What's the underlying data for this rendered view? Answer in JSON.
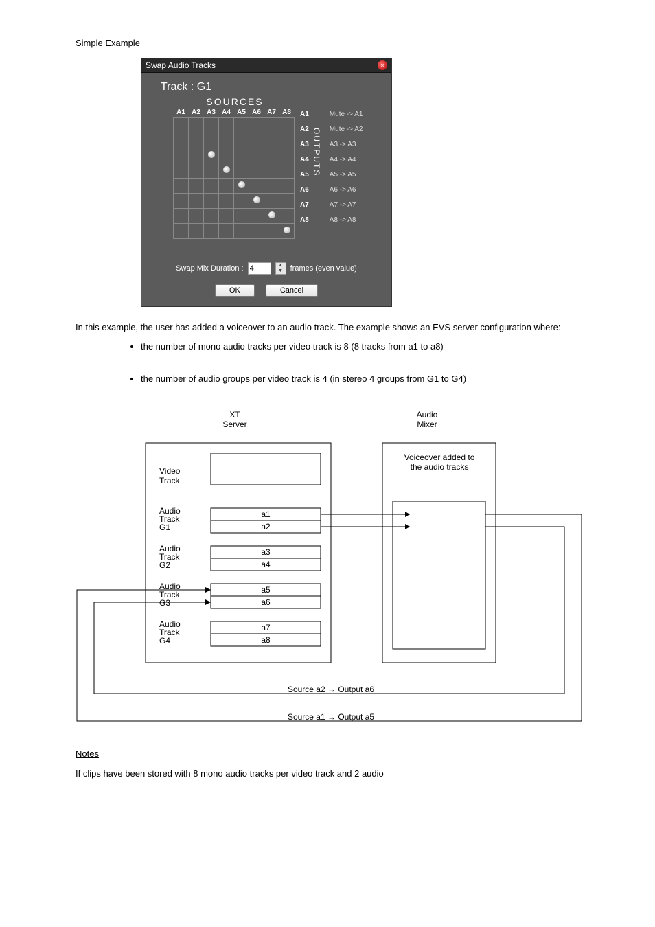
{
  "headings": {
    "simple_example": "Simple Example",
    "notes_heading": "Notes"
  },
  "dialog": {
    "title": "Swap Audio Tracks",
    "track_label": "Track : G1",
    "sources_label": "SOURCES",
    "outputs_label": "OUTPUTS",
    "col_headers": [
      "A1",
      "A2",
      "A3",
      "A4",
      "A5",
      "A6",
      "A7",
      "A8"
    ],
    "row_labels": [
      "A1",
      "A2",
      "A3",
      "A4",
      "A5",
      "A6",
      "A7",
      "A8"
    ],
    "mappings": [
      "Mute -> A1",
      "Mute -> A2",
      "A3 -> A3",
      "A4 -> A4",
      "A5 -> A5",
      "A6 -> A6",
      "A7 -> A7",
      "A8 -> A8"
    ],
    "swap_label": "Swap Mix Duration :",
    "swap_value": "4",
    "swap_suffix": "frames (even value)",
    "ok": "OK",
    "cancel": "Cancel",
    "dots": [
      [
        2,
        2
      ],
      [
        3,
        3
      ],
      [
        4,
        4
      ],
      [
        5,
        5
      ],
      [
        6,
        6
      ],
      [
        7,
        7
      ]
    ]
  },
  "paragraph_intro": "In this example, the user has added a voiceover to an audio track. The example shows an EVS server configuration where:",
  "bullets": [
    "the number of mono audio tracks per video track is 8 (8 tracks from a1 to a8)",
    "the number of audio groups per video track is 4 (in stereo 4 groups from G1 to G4)"
  ],
  "diagram": {
    "xt_server": "XT\nServer",
    "audio_mixer": "Audio\nMixer",
    "voiceover": "Voiceover added to\nthe audio tracks",
    "video_track": "Video\nTrack",
    "g1": "Audio\nTrack\nG1",
    "g2": "Audio\nTrack\nG2",
    "g3": "Audio\nTrack\nG3",
    "g4": "Audio\nTrack\nG4",
    "a": [
      "a1",
      "a2",
      "a3",
      "a4",
      "a5",
      "a6",
      "a7",
      "a8"
    ],
    "caption1": "Source a2 → Output a6",
    "caption2": "Source a1 → Output a5"
  },
  "notes_text": "If clips have been stored with 8 mono audio tracks per video track and 2 audio",
  "chart_data": {
    "type": "table",
    "title": "Swap Audio Tracks matrix (Track G1) — source→output dot positions",
    "columns_sources": [
      "A1",
      "A2",
      "A3",
      "A4",
      "A5",
      "A6",
      "A7",
      "A8"
    ],
    "rows_outputs": [
      "A1",
      "A2",
      "A3",
      "A4",
      "A5",
      "A6",
      "A7",
      "A8"
    ],
    "dot_cells_zero_indexed_row_col": [
      [
        2,
        2
      ],
      [
        3,
        3
      ],
      [
        4,
        4
      ],
      [
        5,
        5
      ],
      [
        6,
        6
      ],
      [
        7,
        7
      ]
    ],
    "resulting_mapping": {
      "A1": "Mute",
      "A2": "Mute",
      "A3": "A3",
      "A4": "A4",
      "A5": "A5",
      "A6": "A6",
      "A7": "A7",
      "A8": "A8"
    },
    "swap_mix_duration_frames": 4
  }
}
